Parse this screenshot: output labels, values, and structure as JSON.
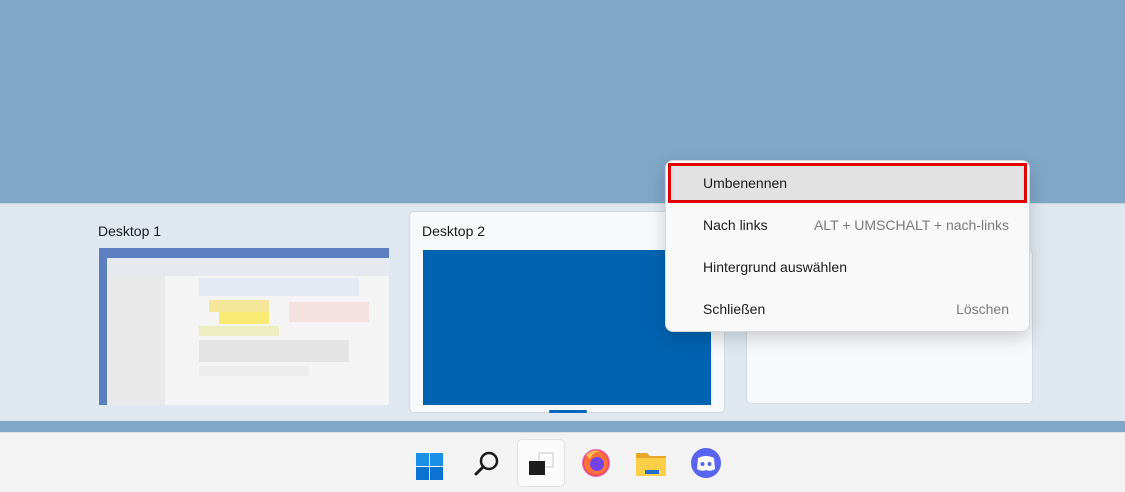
{
  "desktops": [
    {
      "title": "Desktop 1"
    },
    {
      "title": "Desktop 2",
      "active": true
    }
  ],
  "context_menu": {
    "items": [
      {
        "label": "Umbenennen",
        "shortcut": ""
      },
      {
        "label": "Nach links",
        "shortcut": "ALT + UMSCHALT + nach-links"
      },
      {
        "label": "Hintergrund auswählen",
        "shortcut": ""
      },
      {
        "label": "Schließen",
        "shortcut": "Löschen"
      }
    ]
  },
  "taskbar": {
    "icons": [
      "windows-start-icon",
      "search-icon",
      "task-view-icon",
      "firefox-icon",
      "file-explorer-icon",
      "discord-icon"
    ]
  },
  "colors": {
    "wallpaper": "#80a7c8",
    "desktop_2_background": "#0063b1",
    "highlight_outline": "#e00000",
    "accent": "#0067c0",
    "discord": "#5865f2"
  }
}
